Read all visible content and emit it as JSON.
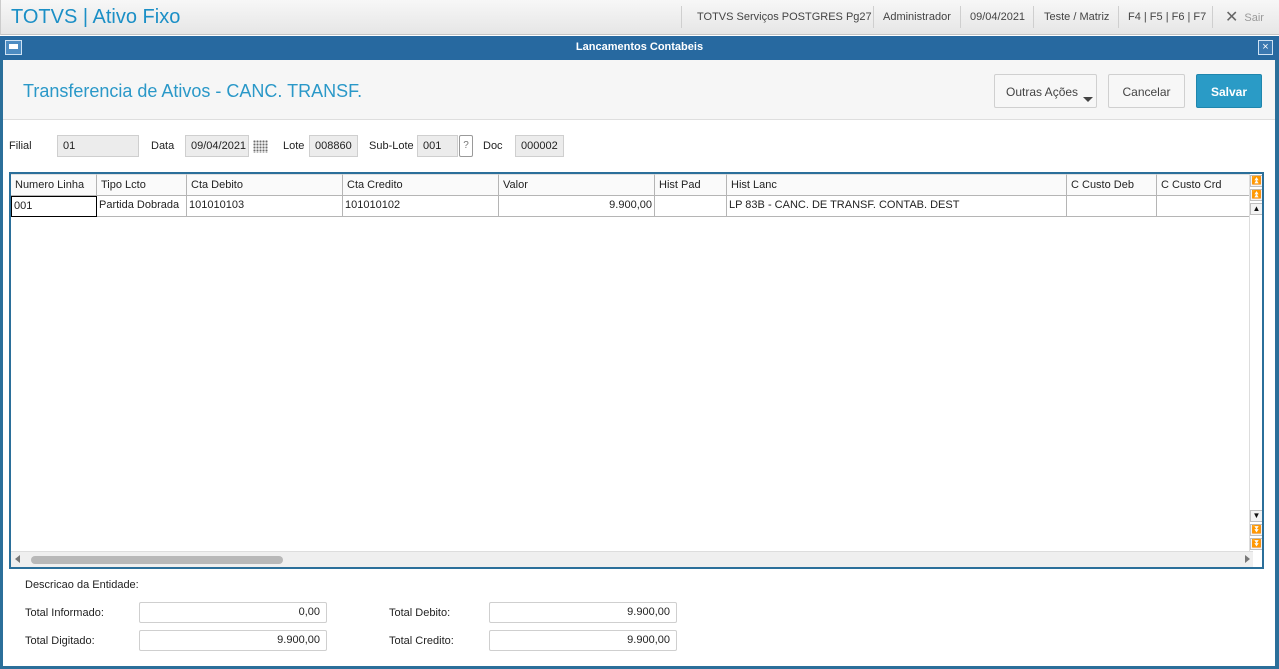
{
  "topbar": {
    "app_title": "TOTVS | Ativo Fixo",
    "environment": "TOTVS Serviços POSTGRES Pg27",
    "user": "Administrador",
    "date": "09/04/2021",
    "company": "Teste / Matriz",
    "shortcuts": "F4 | F5 | F6 | F7",
    "exit_label": "Sair",
    "exit_icon": "close-icon"
  },
  "window": {
    "title": "Lancamentos Contabeis",
    "close_glyph": "×"
  },
  "form": {
    "title": "Transferencia de Ativos - CANC. TRANSF.",
    "actions": {
      "outras_label": "Outras Ações",
      "cancelar_label": "Cancelar",
      "salvar_label": "Salvar"
    },
    "fields": {
      "filial_label": "Filial",
      "filial_value": "01",
      "data_label": "Data",
      "data_value": "09/04/2021",
      "lote_label": "Lote",
      "lote_value": "008860",
      "sublote_label": "Sub-Lote",
      "sublote_value": "001",
      "sublote_help": "?",
      "doc_label": "Doc",
      "doc_value": "000002"
    }
  },
  "grid": {
    "columns": [
      "Numero Linha",
      "Tipo Lcto",
      "Cta Debito",
      "Cta Credito",
      "Valor",
      "Hist Pad",
      "Hist Lanc",
      "C Custo Deb",
      "C Custo Crd"
    ],
    "rows": [
      [
        "001",
        "Partida Dobrada",
        "101010103",
        "101010102",
        "9.900,00",
        "",
        "LP 83B - CANC. DE TRANSF. CONTAB. DEST",
        "",
        ""
      ]
    ]
  },
  "footer": {
    "descricao_label": "Descricao da Entidade:",
    "total_informado_label": "Total Informado:",
    "total_informado_value": "0,00",
    "total_digitado_label": "Total Digitado:",
    "total_digitado_value": "9.900,00",
    "total_debito_label": "Total Debito:",
    "total_debito_value": "9.900,00",
    "total_credito_label": "Total Credito:",
    "total_credito_value": "9.900,00"
  },
  "colors": {
    "brand": "#1b8fc6",
    "window_titlebar": "#2769a0",
    "primary_button": "#2a9bc6"
  }
}
